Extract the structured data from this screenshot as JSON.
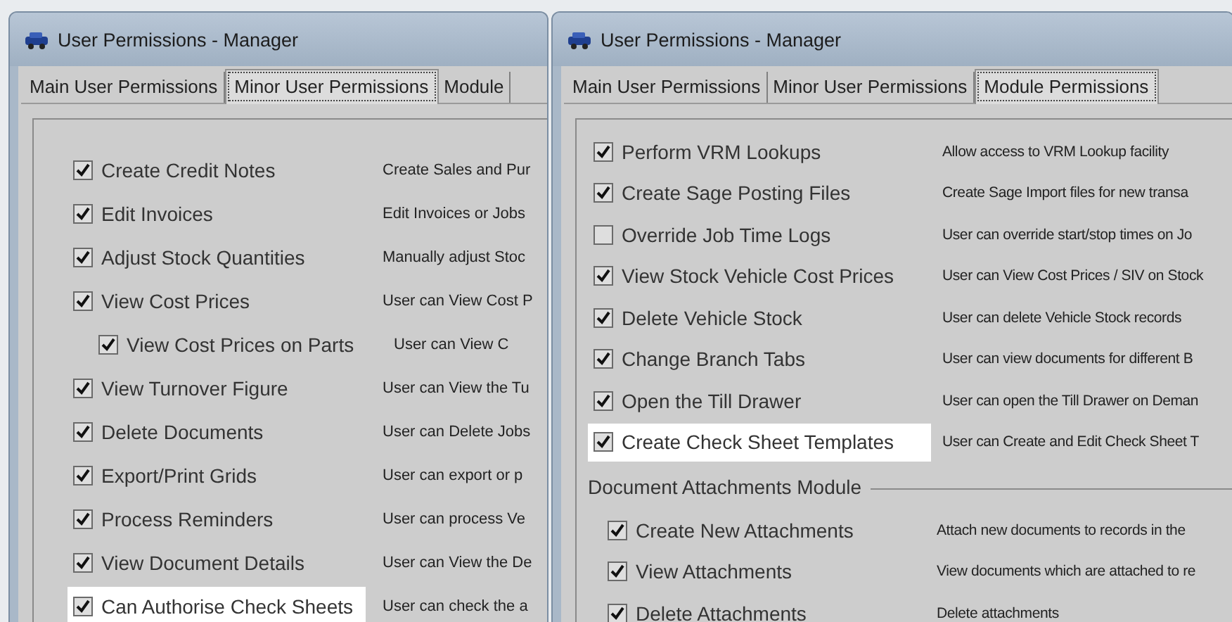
{
  "windows": [
    {
      "title": "User Permissions - Manager",
      "tabs": [
        {
          "label": "Main User Permissions",
          "selected": false
        },
        {
          "label": "Minor User Permissions",
          "selected": true
        },
        {
          "label": "Module",
          "selected": false
        }
      ],
      "permissions": [
        {
          "label": "Create Credit Notes",
          "description": "Create Sales and Pur",
          "checked": true,
          "highlighted": false
        },
        {
          "label": "Edit Invoices",
          "description": "Edit Invoices or Jobs",
          "checked": true,
          "highlighted": false
        },
        {
          "label": "Adjust Stock Quantities",
          "description": "Manually adjust Stoc",
          "checked": true,
          "highlighted": false
        },
        {
          "label": "View Cost Prices",
          "description": "User can View Cost P",
          "checked": true,
          "highlighted": false,
          "children": [
            {
              "label": "View Cost Prices on Parts",
              "description": "User can View C",
              "checked": true,
              "highlighted": false
            }
          ]
        },
        {
          "label": "View Turnover Figure",
          "description": "User can View the Tu",
          "checked": true,
          "highlighted": false
        },
        {
          "label": "Delete Documents",
          "description": "User can Delete Jobs",
          "checked": true,
          "highlighted": false
        },
        {
          "label": "Export/Print Grids",
          "description": "User can export or p",
          "checked": true,
          "highlighted": false
        },
        {
          "label": "Process Reminders",
          "description": "User can process Ve",
          "checked": true,
          "highlighted": false
        },
        {
          "label": "View Document Details",
          "description": "User can View the De",
          "checked": true,
          "highlighted": false
        },
        {
          "label": "Can Authorise Check Sheets",
          "description": "User can check the a",
          "checked": true,
          "highlighted": true
        }
      ]
    },
    {
      "title": "User Permissions - Manager",
      "tabs": [
        {
          "label": "Main User Permissions",
          "selected": false
        },
        {
          "label": "Minor User Permissions",
          "selected": false
        },
        {
          "label": "Module Permissions",
          "selected": true
        }
      ],
      "permissions": [
        {
          "label": "Perform VRM Lookups",
          "description": "Allow access to VRM Lookup facility",
          "checked": true,
          "highlighted": false
        },
        {
          "label": "Create Sage Posting Files",
          "description": "Create Sage Import files for new transa",
          "checked": true,
          "highlighted": false
        },
        {
          "label": "Override Job Time Logs",
          "description": "User can override start/stop times on Jo",
          "checked": false,
          "highlighted": false
        },
        {
          "label": "View Stock Vehicle Cost Prices",
          "description": "User can View Cost Prices / SIV on Stock",
          "checked": true,
          "highlighted": false
        },
        {
          "label": "Delete Vehicle Stock",
          "description": "User can delete Vehicle Stock records",
          "checked": true,
          "highlighted": false
        },
        {
          "label": "Change Branch Tabs",
          "description": "User can view documents for different B",
          "checked": true,
          "highlighted": false
        },
        {
          "label": "Open the Till Drawer",
          "description": "User can open the Till Drawer on Deman",
          "checked": true,
          "highlighted": false
        },
        {
          "label": "Create Check Sheet Templates",
          "description": "User can Create and Edit Check Sheet T",
          "checked": true,
          "highlighted": true
        }
      ],
      "groups": [
        {
          "title": "Document Attachments Module",
          "permissions": [
            {
              "label": "Create New Attachments",
              "description": "Attach new documents to records in the",
              "checked": true,
              "highlighted": false
            },
            {
              "label": "View Attachments",
              "description": "View documents which are attached to re",
              "checked": true,
              "highlighted": false
            },
            {
              "label": "Delete Attachments",
              "description": "Delete attachments",
              "checked": true,
              "highlighted": false
            }
          ]
        }
      ]
    }
  ]
}
